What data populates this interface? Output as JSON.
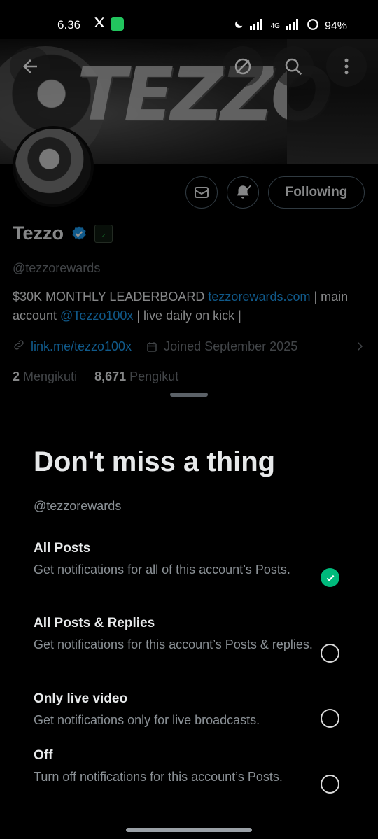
{
  "status_bar": {
    "time": "6.36",
    "network": "4G",
    "battery": "94%"
  },
  "banner": {
    "text": "TEZZO"
  },
  "profile": {
    "display_name": "Tezzo",
    "handle": "@tezzorewards",
    "bio_prefix": "$30K MONTHLY LEADERBOARD ",
    "bio_link": "tezzorewards.com",
    "bio_mid": " | main account ",
    "bio_mention": "@Tezzo100x",
    "bio_suffix": " | live daily on kick |",
    "website": "link.me/tezzo100x",
    "joined": "Joined September 2025",
    "following_count": "2",
    "following_label": "Mengikuti",
    "followers_count": "8,671",
    "followers_label": "Pengikut"
  },
  "actions": {
    "following_label": "Following"
  },
  "sheet": {
    "title": "Don't miss a thing",
    "handle": "@tezzorewards",
    "options": [
      {
        "title": "All Posts",
        "desc": "Get notifications for all of this account’s Posts.",
        "selected": true
      },
      {
        "title": "All Posts & Replies",
        "desc": "Get notifications for this account’s Posts & replies.",
        "selected": false
      },
      {
        "title": "Only live video",
        "desc": "Get notifications only for live broadcasts.",
        "selected": false
      },
      {
        "title": "Off",
        "desc": "Turn off notifications for this account’s Posts.",
        "selected": false
      }
    ]
  },
  "colors": {
    "accent": "#1d9bf0",
    "selected": "#00ba7c"
  }
}
